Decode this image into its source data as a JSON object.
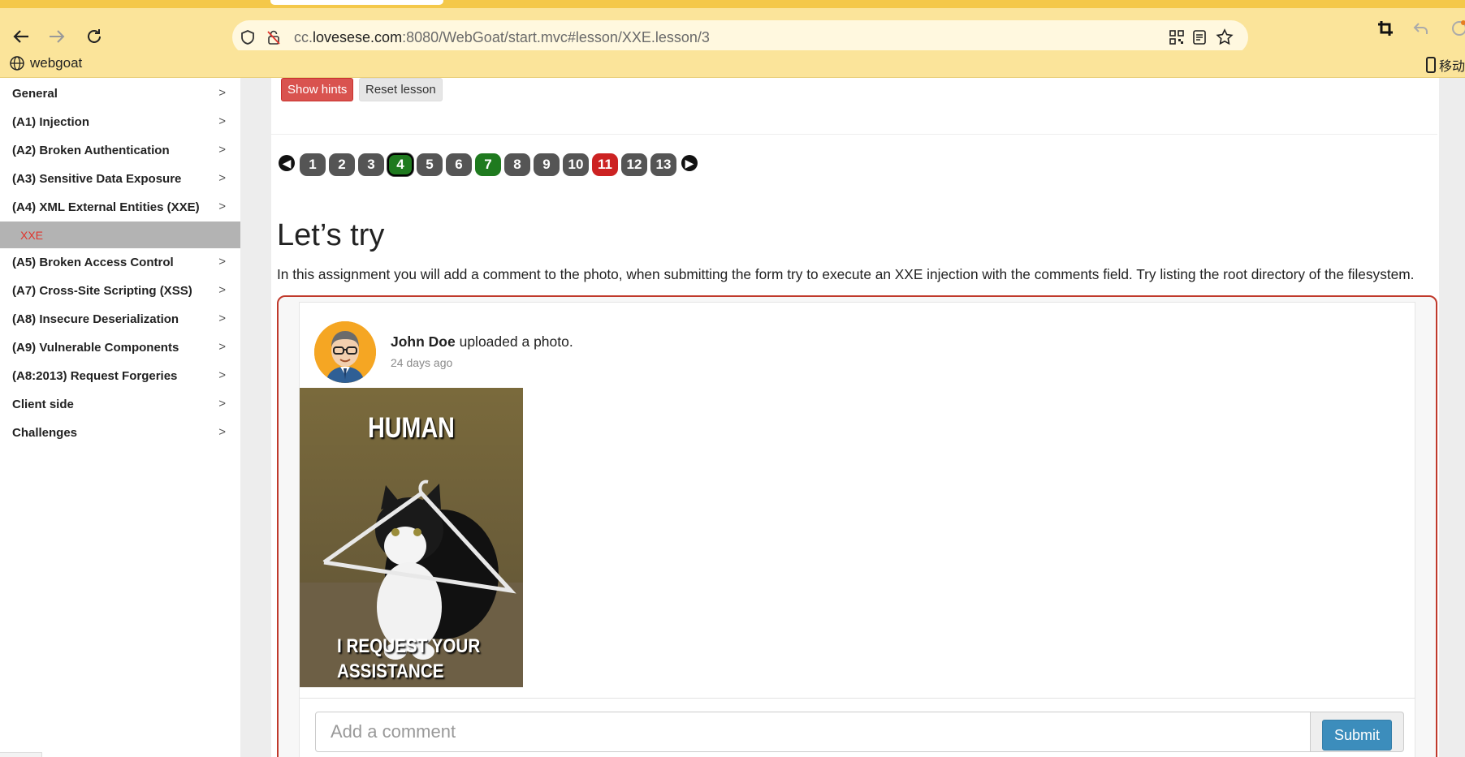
{
  "browser": {
    "url_prefix": "cc.",
    "url_domain": "lovesese.com",
    "url_rest": ":8080/WebGoat/start.mvc#lesson/XXE.lesson/3",
    "bookmark_label": "webgoat",
    "mobile_label": "移动",
    "accent": "#fbe49a"
  },
  "sidebar": {
    "items": [
      {
        "label": "General"
      },
      {
        "label": "(A1) Injection"
      },
      {
        "label": "(A2) Broken Authentication"
      },
      {
        "label": "(A3) Sensitive Data Exposure"
      },
      {
        "label": "(A4) XML External Entities (XXE)"
      },
      {
        "label": "(A5) Broken Access Control"
      },
      {
        "label": "(A7) Cross-Site Scripting (XSS)"
      },
      {
        "label": "(A8) Insecure Deserialization"
      },
      {
        "label": "(A9) Vulnerable Components"
      },
      {
        "label": "(A8:2013) Request Forgeries"
      },
      {
        "label": "Client side"
      },
      {
        "label": "Challenges"
      }
    ],
    "active_sub": "XXE",
    "chevron": ">"
  },
  "lesson": {
    "show_hints": "Show hints",
    "reset_lesson": "Reset lesson",
    "pages": [
      {
        "n": "1",
        "state": "default"
      },
      {
        "n": "2",
        "state": "default"
      },
      {
        "n": "3",
        "state": "default"
      },
      {
        "n": "4",
        "state": "current"
      },
      {
        "n": "5",
        "state": "default"
      },
      {
        "n": "6",
        "state": "default"
      },
      {
        "n": "7",
        "state": "solved"
      },
      {
        "n": "8",
        "state": "default"
      },
      {
        "n": "9",
        "state": "default"
      },
      {
        "n": "10",
        "state": "default"
      },
      {
        "n": "11",
        "state": "failed"
      },
      {
        "n": "12",
        "state": "default"
      },
      {
        "n": "13",
        "state": "default"
      }
    ],
    "title": "Let’s try",
    "description": "In this assignment you will add a comment to the photo, when submitting the form try to execute an XXE injection with the comments field. Try listing the root directory of the filesystem."
  },
  "post": {
    "author": "John Doe",
    "action": " uploaded a photo.",
    "time_ago": "24 days ago",
    "photo_caption_top": "HUMAN",
    "photo_caption_bottom_1": "I REQUEST YOUR",
    "photo_caption_bottom_2": "ASSISTANCE",
    "comment_placeholder": "Add a comment",
    "submit_label": "Submit"
  }
}
